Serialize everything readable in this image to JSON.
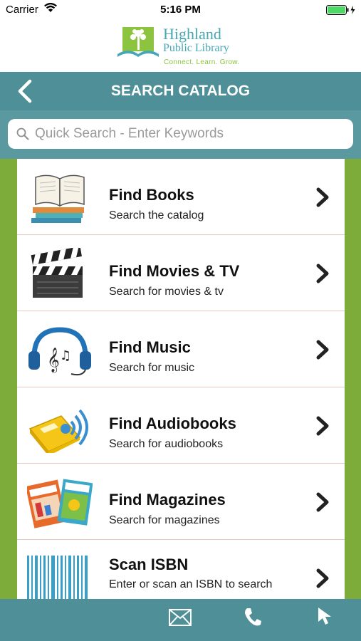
{
  "status_bar": {
    "carrier": "Carrier",
    "time": "5:16 PM"
  },
  "logo": {
    "line1": "Highland",
    "line2": "Public Library",
    "tagline": "Connect. Learn. Grow."
  },
  "nav": {
    "title": "SEARCH CATALOG",
    "back_icon": "chevron-left-icon"
  },
  "search": {
    "placeholder": "Quick Search - Enter Keywords",
    "value": ""
  },
  "items": [
    {
      "title": "Find Books",
      "subtitle": "Search the catalog",
      "icon": "books-icon"
    },
    {
      "title": "Find Movies & TV",
      "subtitle": "Search for movies & tv",
      "icon": "clapperboard-icon"
    },
    {
      "title": "Find Music",
      "subtitle": "Search for music",
      "icon": "headphones-icon"
    },
    {
      "title": "Find Audiobooks",
      "subtitle": "Search for audiobooks",
      "icon": "audiobook-icon"
    },
    {
      "title": "Find Magazines",
      "subtitle": "Search for magazines",
      "icon": "magazines-icon"
    },
    {
      "title": "Scan ISBN",
      "subtitle": "Enter or scan an ISBN to search",
      "icon": "barcode-icon"
    }
  ],
  "bottom_bar": {
    "icons": [
      "mail-icon",
      "phone-icon",
      "cursor-icon"
    ]
  },
  "colors": {
    "teal": "#4e8f98",
    "green": "#7eac3b",
    "brand": "#47a7b6"
  }
}
